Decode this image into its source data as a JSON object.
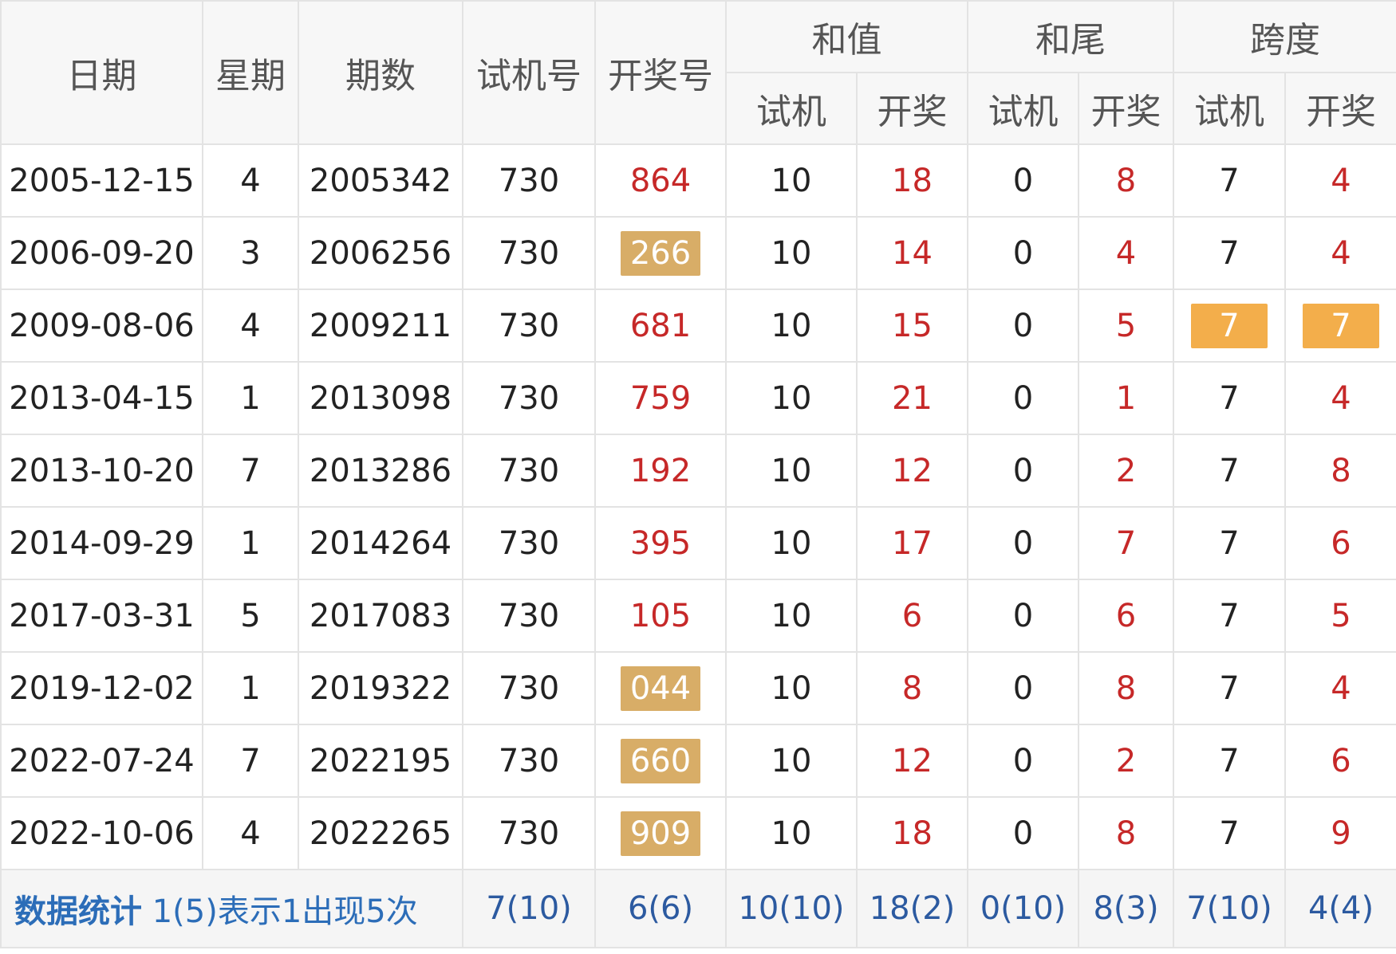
{
  "headers": {
    "date": "日期",
    "weekday": "星期",
    "issue": "期数",
    "trial": "试机号",
    "draw": "开奖号",
    "sum": "和值",
    "tail": "和尾",
    "span": "跨度",
    "sub_trial": "试机",
    "sub_draw": "开奖"
  },
  "rows": [
    {
      "date": "2005-12-15",
      "weekday": "4",
      "issue": "2005342",
      "trial": "730",
      "draw": "864",
      "sum_trial": "10",
      "sum_draw": "18",
      "tail_trial": "0",
      "tail_draw": "8",
      "span_trial": "7",
      "span_draw": "4"
    },
    {
      "date": "2006-09-20",
      "weekday": "3",
      "issue": "2006256",
      "trial": "730",
      "draw": "266",
      "sum_trial": "10",
      "sum_draw": "14",
      "tail_trial": "0",
      "tail_draw": "4",
      "span_trial": "7",
      "span_draw": "4"
    },
    {
      "date": "2009-08-06",
      "weekday": "4",
      "issue": "2009211",
      "trial": "730",
      "draw": "681",
      "sum_trial": "10",
      "sum_draw": "15",
      "tail_trial": "0",
      "tail_draw": "5",
      "span_trial": "7",
      "span_draw": "7"
    },
    {
      "date": "2013-04-15",
      "weekday": "1",
      "issue": "2013098",
      "trial": "730",
      "draw": "759",
      "sum_trial": "10",
      "sum_draw": "21",
      "tail_trial": "0",
      "tail_draw": "1",
      "span_trial": "7",
      "span_draw": "4"
    },
    {
      "date": "2013-10-20",
      "weekday": "7",
      "issue": "2013286",
      "trial": "730",
      "draw": "192",
      "sum_trial": "10",
      "sum_draw": "12",
      "tail_trial": "0",
      "tail_draw": "2",
      "span_trial": "7",
      "span_draw": "8"
    },
    {
      "date": "2014-09-29",
      "weekday": "1",
      "issue": "2014264",
      "trial": "730",
      "draw": "395",
      "sum_trial": "10",
      "sum_draw": "17",
      "tail_trial": "0",
      "tail_draw": "7",
      "span_trial": "7",
      "span_draw": "6"
    },
    {
      "date": "2017-03-31",
      "weekday": "5",
      "issue": "2017083",
      "trial": "730",
      "draw": "105",
      "sum_trial": "10",
      "sum_draw": "6",
      "tail_trial": "0",
      "tail_draw": "6",
      "span_trial": "7",
      "span_draw": "5"
    },
    {
      "date": "2019-12-02",
      "weekday": "1",
      "issue": "2019322",
      "trial": "730",
      "draw": "044",
      "sum_trial": "10",
      "sum_draw": "8",
      "tail_trial": "0",
      "tail_draw": "8",
      "span_trial": "7",
      "span_draw": "4"
    },
    {
      "date": "2022-07-24",
      "weekday": "7",
      "issue": "2022195",
      "trial": "730",
      "draw": "660",
      "sum_trial": "10",
      "sum_draw": "12",
      "tail_trial": "0",
      "tail_draw": "2",
      "span_trial": "7",
      "span_draw": "6"
    },
    {
      "date": "2022-10-06",
      "weekday": "4",
      "issue": "2022265",
      "trial": "730",
      "draw": "909",
      "sum_trial": "10",
      "sum_draw": "18",
      "tail_trial": "0",
      "tail_draw": "8",
      "span_trial": "7",
      "span_draw": "9"
    }
  ],
  "stats": {
    "label": "数据统计",
    "note": "1(5)表示1出现5次",
    "trial": "7(10)",
    "draw": "6(6)",
    "sum_trial": "10(10)",
    "sum_draw": "18(2)",
    "tail_trial": "0(10)",
    "tail_draw": "8(3)",
    "span_trial": "7(10)",
    "span_draw": "4(4)"
  },
  "colors": {
    "draw_red": "#c62828",
    "pill_gold": "#d8ad67",
    "pill_orange": "#f3ae4b",
    "stat_blue": "#2c6db8"
  }
}
